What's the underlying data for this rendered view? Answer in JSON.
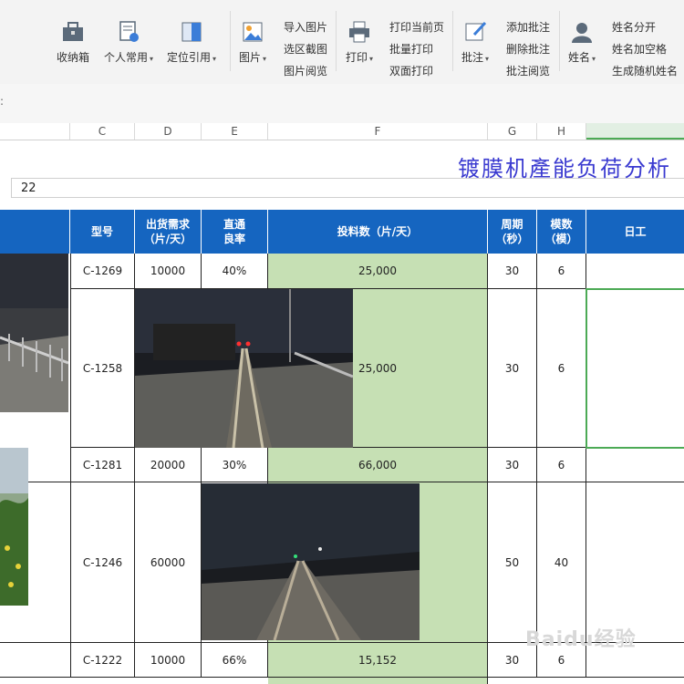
{
  "ribbon": {
    "groups": [
      {
        "label": "收纳箱",
        "icon": "toolbox-icon"
      },
      {
        "label": "个人常用",
        "icon": "personal-icon"
      },
      {
        "label": "定位引用",
        "icon": "locate-icon"
      },
      {
        "label": "图片",
        "icon": "picture-icon"
      },
      {
        "label": "打印",
        "icon": "printer-icon"
      },
      {
        "label": "批注",
        "icon": "comment-icon"
      },
      {
        "label": "姓名",
        "icon": "name-icon"
      }
    ],
    "picture_items": [
      "导入图片",
      "选区截图",
      "图片阅览"
    ],
    "print_items": [
      "打印当前页",
      "批量打印",
      "双面打印"
    ],
    "comment_items": [
      "添加批注",
      "删除批注",
      "批注阅览"
    ],
    "name_items": [
      "姓名分开",
      "姓名加空格",
      "生成随机姓名"
    ]
  },
  "formula": {
    "value": "22"
  },
  "columns": [
    "C",
    "D",
    "E",
    "F",
    "G",
    "H",
    ""
  ],
  "sheet": {
    "title": "镀膜机產能负荷分析",
    "headers": {
      "model": "型号",
      "demand": "出货需求\n（片/天）",
      "yield": "直通\n良率",
      "feed": "投料数（片/天）",
      "cycle": "周期\n（秒）",
      "mold": "模数\n（模）",
      "daily": "日工"
    },
    "rows": [
      {
        "model": "C-1269",
        "demand": "10000",
        "yield": "40%",
        "feed": "25,000",
        "cycle": "30",
        "mold": "6"
      },
      {
        "model": "C-1258",
        "demand": "",
        "yield": "",
        "feed": "25,000",
        "cycle": "30",
        "mold": "6"
      },
      {
        "model": "C-1281",
        "demand": "20000",
        "yield": "30%",
        "feed": "66,000",
        "cycle": "30",
        "mold": "6"
      },
      {
        "model": "C-1246",
        "demand": "60000",
        "yield": "",
        "feed": "",
        "cycle": "50",
        "mold": "40"
      },
      {
        "model": "C-1222",
        "demand": "10000",
        "yield": "66%",
        "feed": "15,152",
        "cycle": "30",
        "mold": "6"
      }
    ]
  },
  "watermark": "Baidu经验",
  "colors": {
    "header_blue": "#1565c0",
    "cell_green": "#c6e0b4",
    "title_blue": "#3a3ad0",
    "select_green": "#4caa55"
  }
}
